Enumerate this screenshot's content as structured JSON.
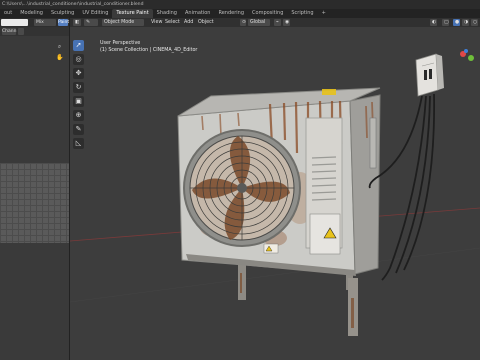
{
  "window": {
    "title": "C:\\Users\\...\\industrial_conditioner\\industrial_conditioner.blend"
  },
  "workspace_tabs": [
    {
      "label": "out"
    },
    {
      "label": "Modeling"
    },
    {
      "label": "Sculpting"
    },
    {
      "label": "UV Editing"
    },
    {
      "label": "Texture Paint"
    },
    {
      "label": "Shading"
    },
    {
      "label": "Animation"
    },
    {
      "label": "Rendering"
    },
    {
      "label": "Compositing"
    },
    {
      "label": "Scripting"
    },
    {
      "label": "+"
    }
  ],
  "active_tab_index": 4,
  "left_panel": {
    "brush_field_value": "",
    "mix_label": "Mix",
    "color_label": "Paint",
    "view_mode_label": "Chann"
  },
  "viewport_header": {
    "object_mode_label": "Object Mode",
    "menus": [
      "View",
      "Select",
      "Add",
      "Object"
    ],
    "orientation_label": "Global"
  },
  "viewport_info": {
    "line1": "User Perspective",
    "line2": "(1) Scene Collection | CINEMA_4D_Editor"
  },
  "tools": [
    {
      "icon": "select-cursor-icon",
      "glyph": "➚",
      "active": true
    },
    {
      "icon": "cursor-icon",
      "glyph": "◎",
      "active": false
    },
    {
      "icon": "move-icon",
      "glyph": "✥",
      "active": false
    },
    {
      "icon": "rotate-icon",
      "glyph": "↻",
      "active": false
    },
    {
      "icon": "scale-icon",
      "glyph": "▣",
      "active": false
    },
    {
      "icon": "transform-icon",
      "glyph": "⊕",
      "active": false
    },
    {
      "icon": "annotate-icon",
      "glyph": "✎",
      "active": false
    },
    {
      "icon": "measure-icon",
      "glyph": "◺",
      "active": false
    }
  ],
  "colors": {
    "accent": "#4772b3",
    "viewport_bg": "#3d3d3d",
    "header_bg": "#303030",
    "unit_body": "#c9c9c6",
    "rust": "#8a4a24",
    "warning_yellow": "#e8c21a"
  }
}
